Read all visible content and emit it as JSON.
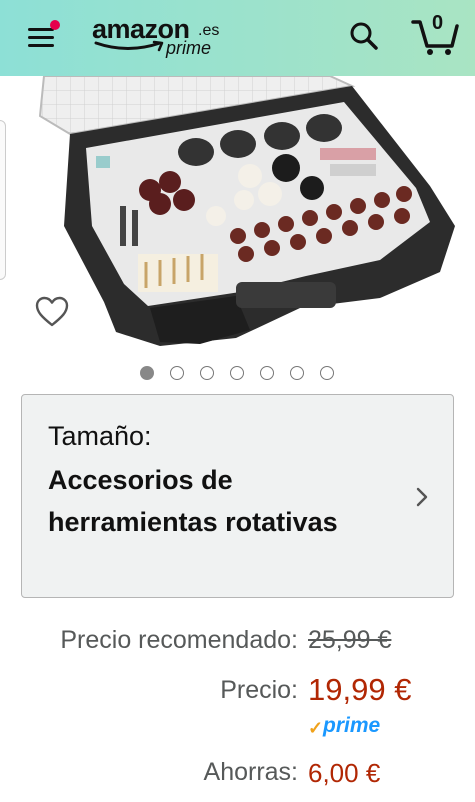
{
  "header": {
    "logo_word": "amazon",
    "logo_tld": ".es",
    "logo_sub": "prime",
    "cart_count": "0",
    "icons": {
      "menu": "hamburger-icon",
      "search": "search-icon",
      "cart": "cart-icon",
      "notification": "notification-dot-icon"
    }
  },
  "gallery": {
    "image_count": 7,
    "active_index": 0,
    "wishlist_icon": "heart-outline-icon"
  },
  "size_selector": {
    "label": "Tamaño:",
    "value": "Accesorios de herramientas rotativas",
    "icon": "chevron-right-icon"
  },
  "pricing": {
    "list_label": "Precio recomendado:",
    "list_value": "25,99 €",
    "price_label": "Precio:",
    "price_value": "19,99 €",
    "prime_label": "prime",
    "savings_label": "Ahorras:",
    "savings_value": "6,00 €"
  },
  "colors": {
    "header_start": "#8de0d6",
    "header_end": "#a9e4c3",
    "price_red": "#b12704",
    "prime_blue": "#1a98ff",
    "prime_check": "#f0a21b",
    "notification": "#e5004c"
  }
}
